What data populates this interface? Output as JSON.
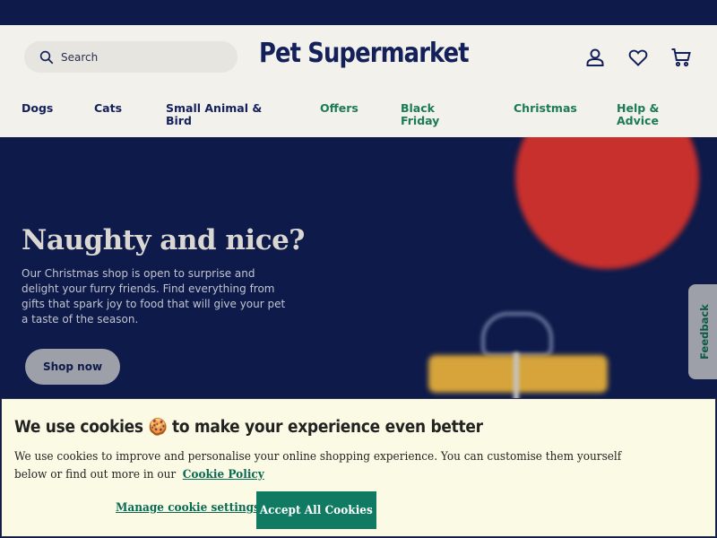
{
  "header": {
    "search_placeholder": "Search",
    "logo": "Pet Supermarket",
    "icons": [
      "account-icon",
      "heart-icon",
      "cart-icon"
    ]
  },
  "nav": {
    "items": [
      {
        "label": "Dogs"
      },
      {
        "label": "Cats"
      },
      {
        "label": "Small Animal & Bird"
      },
      {
        "label": "Offers"
      },
      {
        "label": "Black Friday"
      },
      {
        "label": "Christmas"
      },
      {
        "label": "Help & Advice"
      }
    ]
  },
  "hero": {
    "title": "Naughty and nice?",
    "text": "Our Christmas shop is open to surprise and delight your furry friends. Find everything from gifts that spark joy to food that will give your pet a taste of the season.",
    "cta": "Shop now"
  },
  "feedback": {
    "label": "Feedback"
  },
  "cookie": {
    "title": "We use cookies 🍪 to make your experience even better",
    "text": "We use cookies to improve and personalise your online shopping experience. You can customise them yourself below or find out more in our",
    "policy_link": "Cookie Policy",
    "manage_label": "Manage cookie settings",
    "accept_label": "Accept All Cookies"
  },
  "colors": {
    "navy": "#0d1a4a",
    "accent_green": "#107a63",
    "nav_green": "#1c7a55",
    "cookie_bg": "#fbfbe5"
  }
}
